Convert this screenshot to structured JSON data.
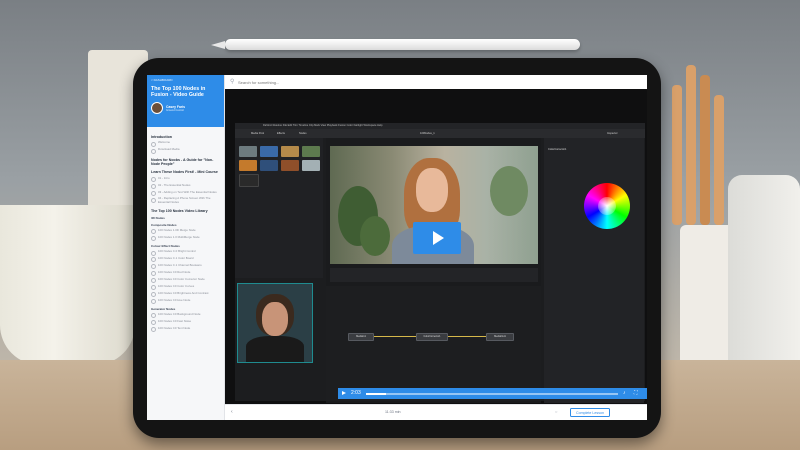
{
  "search": {
    "placeholder": "Search for something..."
  },
  "course": {
    "back_label": "< DASHBOARD",
    "title": "The Top 100 Nodes in Fusion - Video Guide",
    "author_name": "Casey Faris",
    "author_role": "Ground Control"
  },
  "sidebar": {
    "sections": [
      {
        "title": "Introduction",
        "subsections": [
          {
            "title": "",
            "lessons": [
              "Welcome",
              "Download Media"
            ]
          }
        ]
      },
      {
        "title": "Nodes for Noobs - A Guide for \"Non-Node People\"",
        "subsections": []
      },
      {
        "title": "Learn These Nodes First! - Mini Course",
        "subsections": [
          {
            "title": "",
            "lessons": [
              "01 - Intro",
              "02 - The Essential Nodes",
              "03 - Adding on Text With The Essential Nodes",
              "04 - Replacing A Phone Screen With The Essential Nodes"
            ]
          }
        ]
      },
      {
        "title": "The Top 100 Nodes Video Library",
        "subsections": [
          {
            "title": "3D Nodes",
            "lessons": []
          },
          {
            "title": "Composite Nodes",
            "lessons": [
              "100 Nodes 1.0D Merge Node",
              "100 Nodes 1.0 MultiMerge Node"
            ]
          },
          {
            "title": "Colour Effect Nodes",
            "lessons": [
              "100 Nodes C.0 Bright Control",
              "100 Nodes C.1 Color Board",
              "100 Nodes C.1 Channel Booleans",
              "100 Nodes C0 Red Node",
              "100 Nodes C0 Color Corrector Node",
              "100 Nodes C0 Color Curves",
              "100 Nodes C0 Brightness And Contrast",
              "100 Nodes C0 Hue Node"
            ]
          },
          {
            "title": "Generator Nodes",
            "lessons": [
              "100 Nodes C0 Background Node",
              "100 Nodes C0 Fast Noise",
              "100 Nodes C0 Text Node"
            ]
          }
        ]
      }
    ]
  },
  "resolve": {
    "menu": "DaVinci Resolve  File  Edit  Trim  Timeline  Clip  Mark  View  Playback  Fusion  Color  Fairlight  Workspace  Help",
    "tabs": [
      "Media Pool",
      "Effects",
      "Nodes",
      "Untitled 1",
      "Inspector"
    ],
    "clip_title": "100Nodes_1",
    "timecode": "00:00:01:00",
    "frame_count": "57.0",
    "node_labels": [
      "MediaIn1",
      "ColorCorrector1",
      "MediaOut1"
    ],
    "inspector_title": "ColorCorrector1",
    "inspector_tabs": [
      "Correction",
      "Ranges",
      "Options",
      "Settings"
    ]
  },
  "player": {
    "time": "2:03",
    "progress": 0.08
  },
  "footer": {
    "duration": "11:33 min",
    "complete_label": "Complete Lesson"
  },
  "colors": {
    "accent": "#2e8ce8",
    "sidebar_bg": "#f6f7f9"
  },
  "icons": [
    "search-icon",
    "play-icon",
    "volume-icon",
    "fullscreen-icon",
    "previous-icon",
    "next-icon"
  ]
}
